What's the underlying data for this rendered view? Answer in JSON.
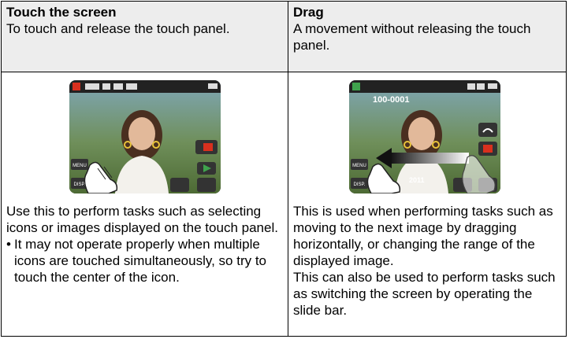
{
  "touch": {
    "title": "Touch the screen",
    "description": "To touch and release the touch panel.",
    "body": "Use this to perform tasks such as selecting icons or images displayed on the touch panel.",
    "note_bullet": "•",
    "note": "It may not operate properly when multiple icons are touched simultaneously, so try to touch the center of the icon.",
    "screen_labels": {
      "menu": "MENU",
      "disp": "DISP."
    }
  },
  "drag": {
    "title": "Drag",
    "description": "A movement without releasing the touch panel.",
    "body": "This is used when performing tasks such as moving to the next image by dragging horizontally, or changing the range of the displayed image.",
    "body2": "This can also be used to perform tasks such as switching the screen by operating the slide bar.",
    "screen_labels": {
      "file_number": "100-0001",
      "menu": "MENU",
      "disp": "DISP.",
      "date": "2011"
    }
  },
  "colors": {
    "header_bg": "#ededed",
    "record_red": "#d9301e",
    "play_green": "#3fa34d"
  }
}
